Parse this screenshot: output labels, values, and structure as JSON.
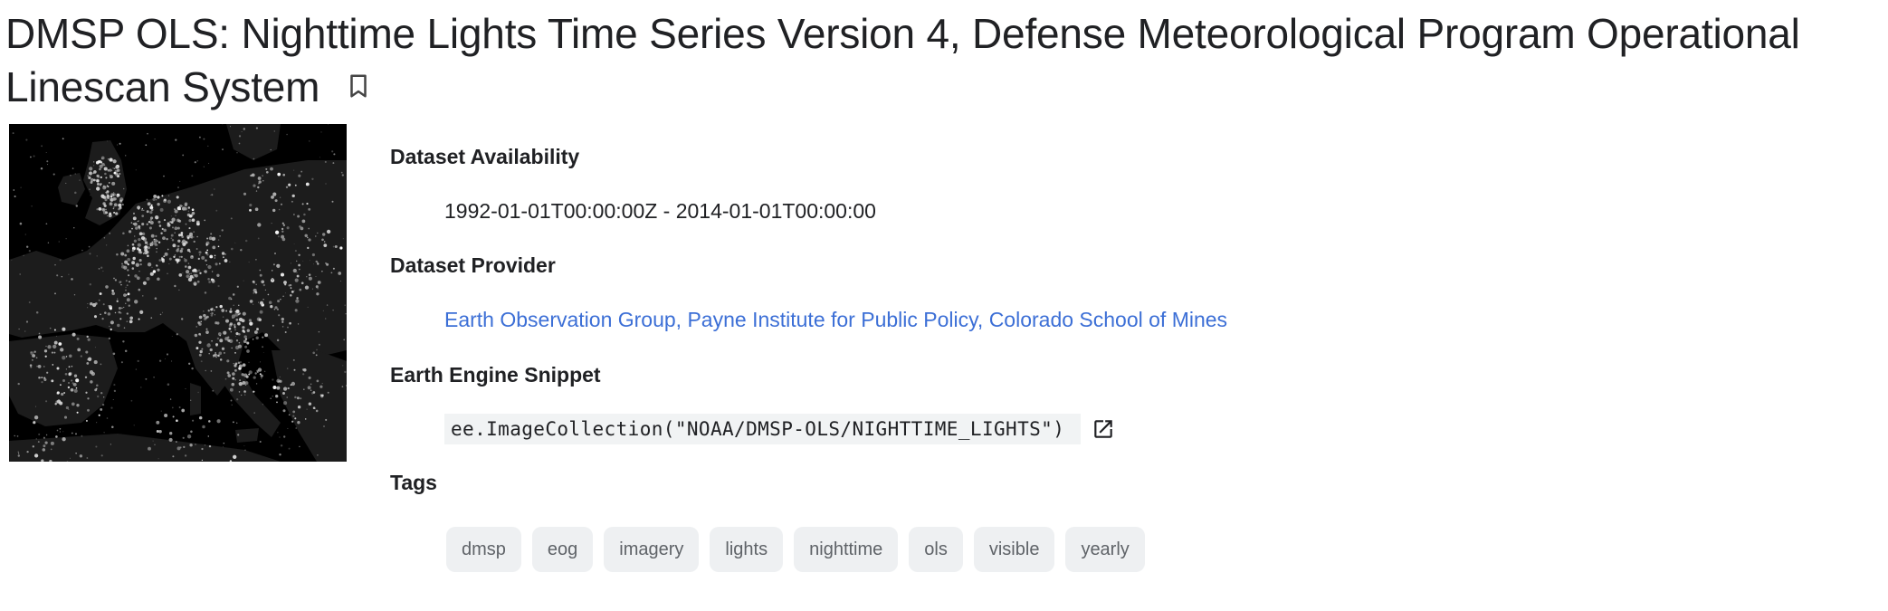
{
  "page": {
    "title": "DMSP OLS: Nighttime Lights Time Series Version 4, Defense Meteorological Program Operational Linescan System",
    "bookmark_icon": "bookmark-outline-icon"
  },
  "thumbnail": {
    "description_icon": "nighttime-lights-thumbnail"
  },
  "details": {
    "availability": {
      "label": "Dataset Availability",
      "value": "1992-01-01T00:00:00Z - 2014-01-01T00:00:00"
    },
    "provider": {
      "label": "Dataset Provider",
      "value": "Earth Observation Group, Payne Institute for Public Policy, Colorado School of Mines"
    },
    "snippet": {
      "label": "Earth Engine Snippet",
      "value": "ee.ImageCollection(\"NOAA/DMSP-OLS/NIGHTTIME_LIGHTS\")",
      "icon": "open-in-new-icon"
    },
    "tags": {
      "label": "Tags",
      "items": [
        "dmsp",
        "eog",
        "imagery",
        "lights",
        "nighttime",
        "ols",
        "visible",
        "yearly"
      ]
    }
  },
  "colors": {
    "link": "#3c6fd6",
    "chip_bg": "#eef0f2",
    "chip_text": "#5f6368",
    "code_bg": "#f1f3f4"
  }
}
